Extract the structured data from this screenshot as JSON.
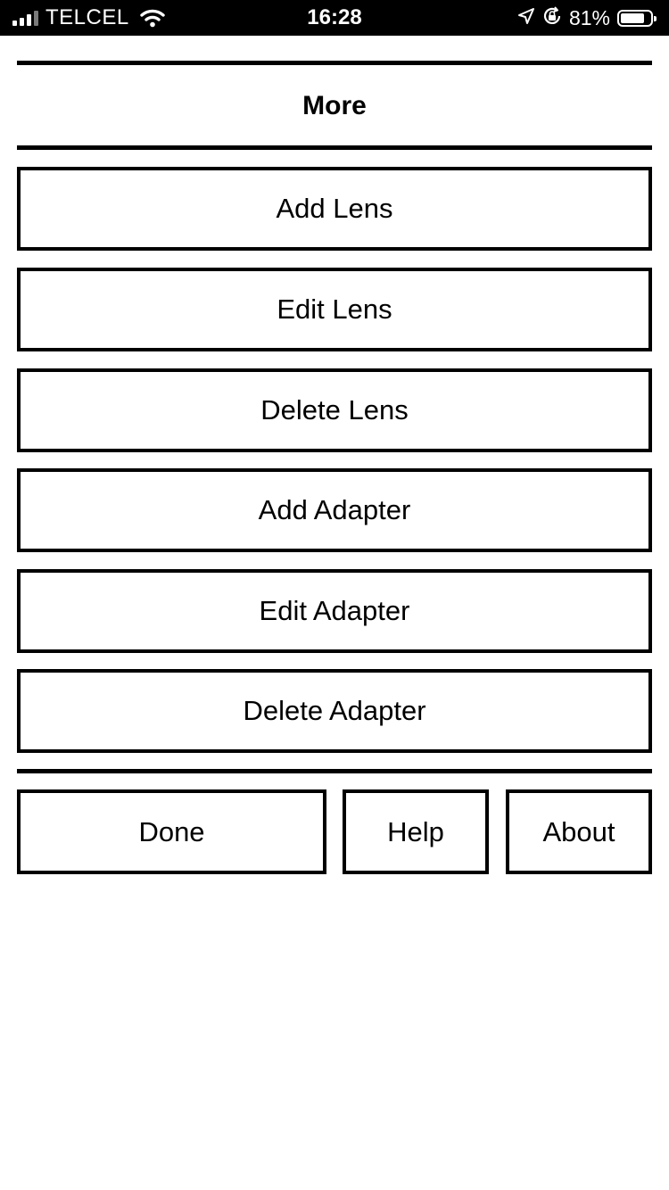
{
  "status_bar": {
    "carrier": "TELCEL",
    "time": "16:28",
    "battery_percent": "81%",
    "battery_level": 0.81,
    "icons": [
      "signal-icon",
      "wifi-icon",
      "location-icon",
      "orientation-lock-icon",
      "battery-icon"
    ]
  },
  "header": {
    "title": "More"
  },
  "actions": {
    "add_lens": "Add Lens",
    "edit_lens": "Edit Lens",
    "delete_lens": "Delete Lens",
    "add_adapter": "Add Adapter",
    "edit_adapter": "Edit Adapter",
    "delete_adapter": "Delete Adapter"
  },
  "footer": {
    "done": "Done",
    "help": "Help",
    "about": "About"
  },
  "colors": {
    "background": "#ffffff",
    "foreground": "#000000",
    "status_bar": "#000000"
  }
}
